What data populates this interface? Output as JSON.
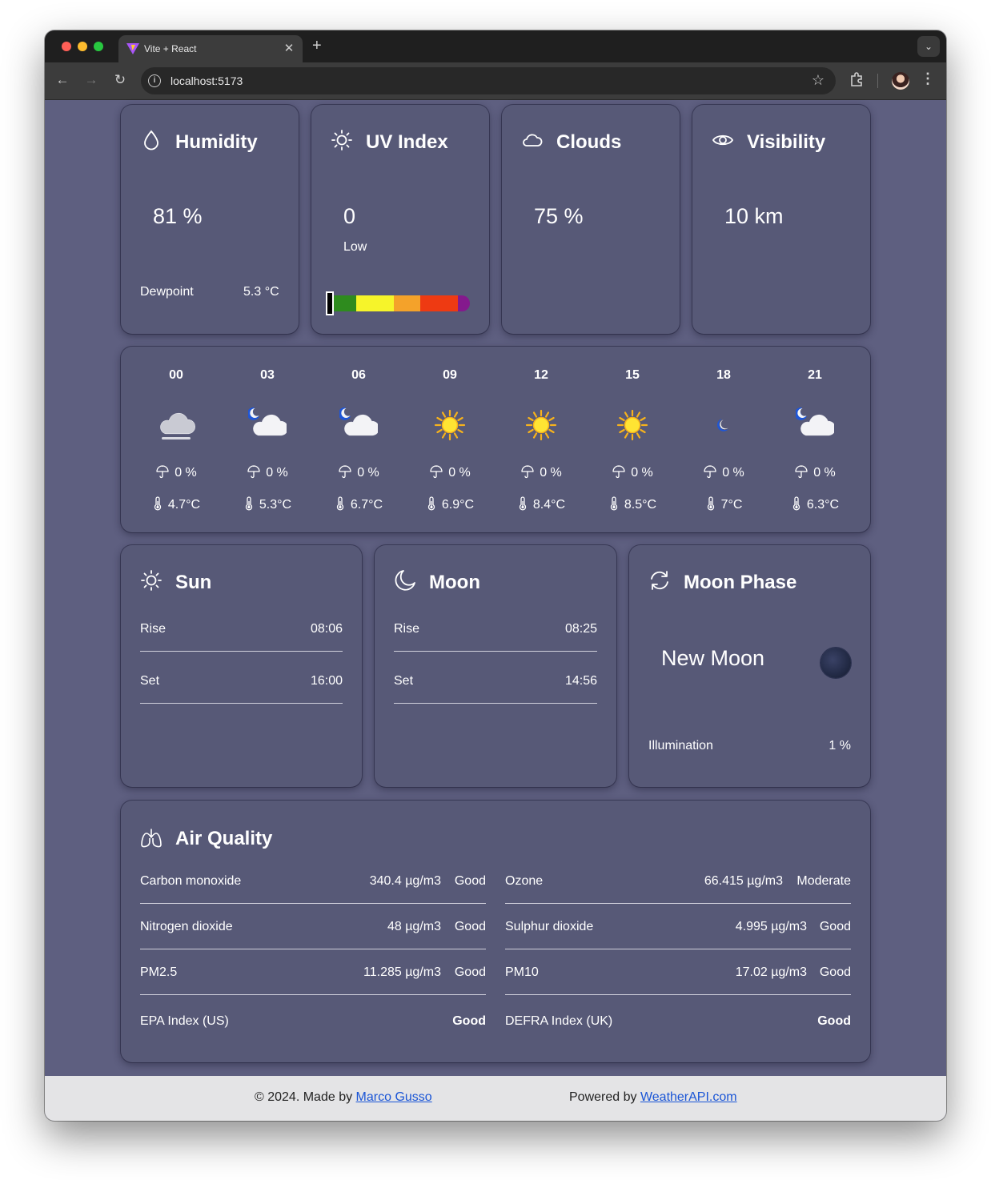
{
  "browser": {
    "tab_title": "Vite + React",
    "tab_close": "✕",
    "new_tab": "+",
    "url": "localhost:5173",
    "nav": {
      "back": "←",
      "forward": "→",
      "reload": "↻"
    },
    "star": "☆",
    "menu": "⋮",
    "tabs_dropdown": "⌄"
  },
  "humidity": {
    "title": "Humidity",
    "value": "81 %",
    "dewpoint_label": "Dewpoint",
    "dewpoint_value": "5.3 °C",
    "icon": "droplet-icon"
  },
  "uv": {
    "title": "UV Index",
    "value": "0",
    "level": "Low",
    "fraction": 0,
    "icon": "sun-icon",
    "scale_colors": [
      "#2e8b1e",
      "#f6f42a",
      "#f4a22a",
      "#ee3a12",
      "#84198d"
    ]
  },
  "clouds": {
    "title": "Clouds",
    "value": "75 %",
    "icon": "cloud-icon"
  },
  "visibility": {
    "title": "Visibility",
    "value": "10 km",
    "icon": "eye-icon"
  },
  "hourly": [
    {
      "hour": "00",
      "icon": "fog-cloud-icon",
      "rain": "0 %",
      "temp": "4.7°C"
    },
    {
      "hour": "03",
      "icon": "moon-cloud-icon",
      "rain": "0 %",
      "temp": "5.3°C"
    },
    {
      "hour": "06",
      "icon": "moon-cloud-icon",
      "rain": "0 %",
      "temp": "6.7°C"
    },
    {
      "hour": "09",
      "icon": "sun-icon",
      "rain": "0 %",
      "temp": "6.9°C"
    },
    {
      "hour": "12",
      "icon": "sun-icon",
      "rain": "0 %",
      "temp": "8.4°C"
    },
    {
      "hour": "15",
      "icon": "sun-icon",
      "rain": "0 %",
      "temp": "8.5°C"
    },
    {
      "hour": "18",
      "icon": "moon-icon",
      "rain": "0 %",
      "temp": "7°C"
    },
    {
      "hour": "21",
      "icon": "moon-cloud-icon",
      "rain": "0 %",
      "temp": "6.3°C"
    }
  ],
  "sun": {
    "title": "Sun",
    "rise_label": "Rise",
    "rise": "08:06",
    "set_label": "Set",
    "set": "16:00",
    "icon": "sun-icon"
  },
  "moon": {
    "title": "Moon",
    "rise_label": "Rise",
    "rise": "08:25",
    "set_label": "Set",
    "set": "14:56",
    "icon": "crescent-icon"
  },
  "moon_phase": {
    "title": "Moon Phase",
    "phase": "New Moon",
    "illumination_label": "Illumination",
    "illumination": "1 %",
    "icon": "refresh-icon"
  },
  "air_quality": {
    "title": "Air Quality",
    "icon": "lungs-icon",
    "left": [
      {
        "name": "Carbon monoxide",
        "value": "340.4 µg/m3",
        "status": "Good"
      },
      {
        "name": "Nitrogen dioxide",
        "value": "48 µg/m3",
        "status": "Good"
      },
      {
        "name": "PM2.5",
        "value": "11.285 µg/m3",
        "status": "Good"
      }
    ],
    "right": [
      {
        "name": "Ozone",
        "value": "66.415 µg/m3",
        "status": "Moderate"
      },
      {
        "name": "Sulphur dioxide",
        "value": "4.995 µg/m3",
        "status": "Good"
      },
      {
        "name": "PM10",
        "value": "17.02 µg/m3",
        "status": "Good"
      }
    ],
    "epa_label": "EPA Index (US)",
    "epa_value": "Good",
    "defra_label": "DEFRA Index (UK)",
    "defra_value": "Good"
  },
  "footer": {
    "made_prefix": "© 2024. Made by",
    "author": "Marco Gusso",
    "powered_prefix": "Powered by",
    "provider": "WeatherAPI.com"
  }
}
